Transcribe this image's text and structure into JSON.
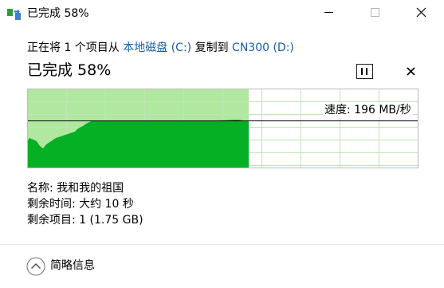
{
  "window": {
    "title": "已完成 58%"
  },
  "header": {
    "prefix": "正在将 1 个项目从",
    "source": "本地磁盘 (C:)",
    "middle": "复制到",
    "destination": "CN300 (D:)",
    "status": "已完成 58%"
  },
  "progress": {
    "percent": 58
  },
  "speed": {
    "label": "速度: 196 MB/秒"
  },
  "details": {
    "name_label": "名称:",
    "name_value": "我和我的祖国",
    "time_label": "剩余时间:",
    "time_value": "大约 10 秒",
    "items_label": "剩余项目:",
    "items_value": "1 (1.75 GB)"
  },
  "footer": {
    "toggle_label": "简略信息"
  },
  "colors": {
    "progress_fill": "#b0e8a0",
    "speed_fill": "#06b025",
    "grid": "#bfe6b6",
    "border": "#bcbcbc",
    "link": "#1a5ea8"
  },
  "icons": {
    "app": "copy-files-icon",
    "pause": "pause-icon",
    "cancel": "close-icon",
    "collapse": "chevron-up-icon"
  }
}
